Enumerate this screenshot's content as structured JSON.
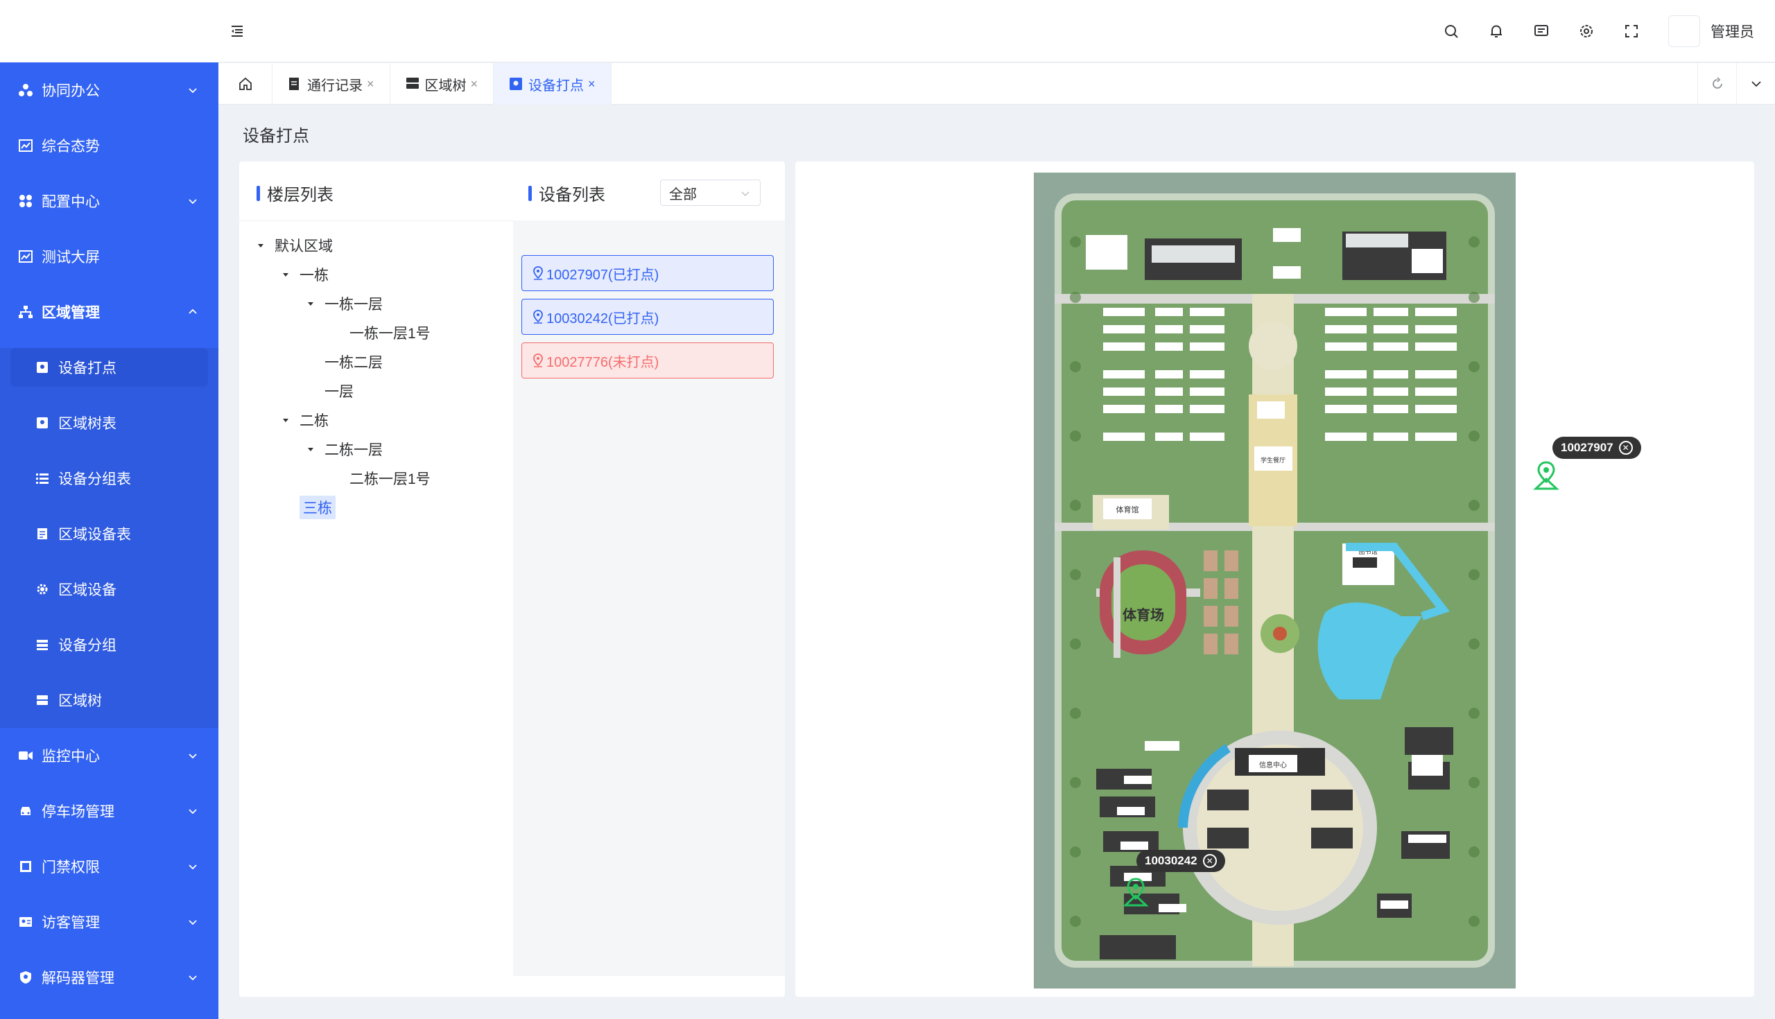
{
  "header": {
    "username": "管理员",
    "icons": [
      "search-icon",
      "bell-icon",
      "message-icon",
      "settings-icon",
      "fullscreen-icon"
    ]
  },
  "sidebar": {
    "items": [
      {
        "label": "协同办公",
        "icon": "collab-icon",
        "has_children": true
      },
      {
        "label": "综合态势",
        "icon": "chart-icon",
        "has_children": false
      },
      {
        "label": "配置中心",
        "icon": "grid-icon",
        "has_children": true
      },
      {
        "label": "测试大屏",
        "icon": "chart-icon",
        "has_children": false
      },
      {
        "label": "区域管理",
        "icon": "sitemap-icon",
        "has_children": true,
        "expanded": true
      }
    ],
    "submenu": [
      {
        "label": "设备打点",
        "icon": "map-pin-icon",
        "active": true
      },
      {
        "label": "区域树表",
        "icon": "map-pin-icon"
      },
      {
        "label": "设备分组表",
        "icon": "list-icon"
      },
      {
        "label": "区域设备表",
        "icon": "doc-icon"
      },
      {
        "label": "区域设备",
        "icon": "gear-icon"
      },
      {
        "label": "设备分组",
        "icon": "layers-icon"
      },
      {
        "label": "区域树",
        "icon": "server-icon"
      }
    ],
    "items_after": [
      {
        "label": "监控中心",
        "icon": "video-icon"
      },
      {
        "label": "停车场管理",
        "icon": "car-icon"
      },
      {
        "label": "门禁权限",
        "icon": "door-icon"
      },
      {
        "label": "访客管理",
        "icon": "id-card-icon"
      },
      {
        "label": "解码器管理",
        "icon": "shield-icon"
      }
    ]
  },
  "tabs": [
    {
      "label": "通行记录",
      "icon": "doc-icon"
    },
    {
      "label": "区域树",
      "icon": "server-icon"
    },
    {
      "label": "设备打点",
      "icon": "map-pin-icon",
      "active": true
    }
  ],
  "page": {
    "title": "设备打点",
    "floor_list_title": "楼层列表",
    "device_list_title": "设备列表",
    "filter_value": "全部"
  },
  "tree": [
    {
      "label": "默认区域",
      "level": 0,
      "expanded": true
    },
    {
      "label": "一栋",
      "level": 1,
      "expanded": true
    },
    {
      "label": "一栋一层",
      "level": 2,
      "expanded": true
    },
    {
      "label": "一栋一层1号",
      "level": 3,
      "leaf": true
    },
    {
      "label": "一栋二层",
      "level": 2,
      "leaf": true
    },
    {
      "label": "一层",
      "level": 2,
      "leaf": true
    },
    {
      "label": "二栋",
      "level": 1,
      "expanded": true
    },
    {
      "label": "二栋一层",
      "level": 2,
      "expanded": true
    },
    {
      "label": "二栋一层1号",
      "level": 3,
      "leaf": true
    },
    {
      "label": "三栋",
      "level": 1,
      "leaf": true,
      "selected": true
    }
  ],
  "devices": [
    {
      "label": "10027907(已打点)",
      "status": "done"
    },
    {
      "label": "10030242(已打点)",
      "status": "done"
    },
    {
      "label": "10027776(未打点)",
      "status": "todo"
    }
  ],
  "map": {
    "markers": [
      {
        "id": "10027907"
      },
      {
        "id": "10030242"
      }
    ],
    "labels": {
      "stadium": "体育场",
      "gym": "体育馆",
      "library": "图书馆",
      "cafeteria": "学生餐厅",
      "info_center": "信息中心"
    }
  },
  "colors": {
    "primary": "#3363f2",
    "danger": "#f56c6c",
    "marker_green": "#22c55e"
  }
}
